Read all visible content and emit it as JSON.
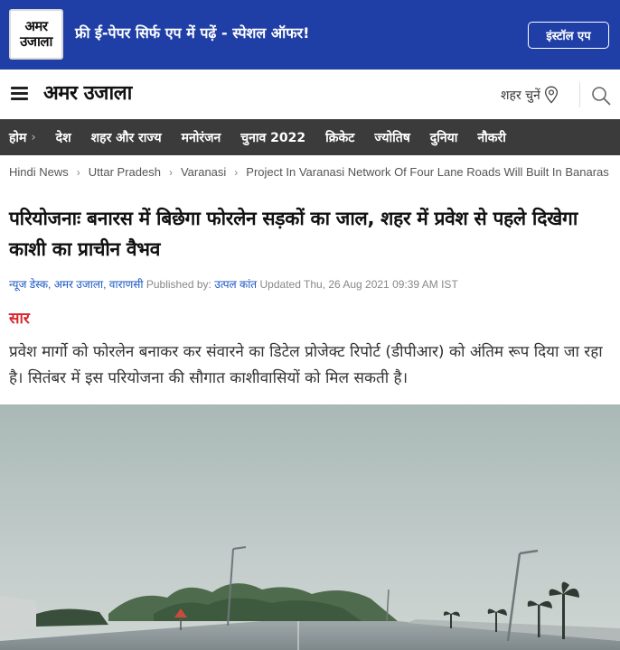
{
  "promo": {
    "logo_line1": "अमर",
    "logo_line2": "उजाला",
    "text": "फ्री ई-पेपर सिर्फ एप में पढ़ें - स्पेशल ऑफर!",
    "install_label": "इंस्टॉल एप"
  },
  "header": {
    "brand": "अमर उजाला",
    "city_label": "शहर चुनें"
  },
  "nav": {
    "items": [
      "होम",
      "देश",
      "शहर और राज्य",
      "मनोरंजन",
      "चुनाव 2022",
      "क्रिकेट",
      "ज्योतिष",
      "दुनिया",
      "नौकरी"
    ]
  },
  "breadcrumb": [
    "Hindi News",
    "Uttar Pradesh",
    "Varanasi",
    "Project In Varanasi Network Of Four Lane Roads Will Built In Banaras"
  ],
  "article": {
    "title": "परियोजनाः बनारस में बिछेगा फोरलेन सड़कों का जाल, शहर में प्रवेश से पहले दिखेगा काशी का प्राचीन वैभव",
    "byline": {
      "author": "न्यूज डेस्क, अमर उजाला, वाराणसी",
      "published_label": "Published by:",
      "publisher": "उत्पल कांत",
      "updated": "Updated Thu, 26 Aug 2021 09:39 AM IST"
    },
    "summary_label": "सार",
    "summary": "प्रवेश मार्गो को फोरलेन बनाकर कर संवारने का डिटेल प्रोजेक्ट रिपोर्ट (डीपीआर) को अंतिम रूप दिया जा रहा है। सितंबर में इस परियोजना की सौगात काशीवासियों को मिल सकती है।"
  },
  "colors": {
    "promo_bg": "#1f3fa6",
    "nav_bg": "#3b3b3b",
    "accent_red": "#d6262f",
    "link_blue": "#1a56c4"
  }
}
